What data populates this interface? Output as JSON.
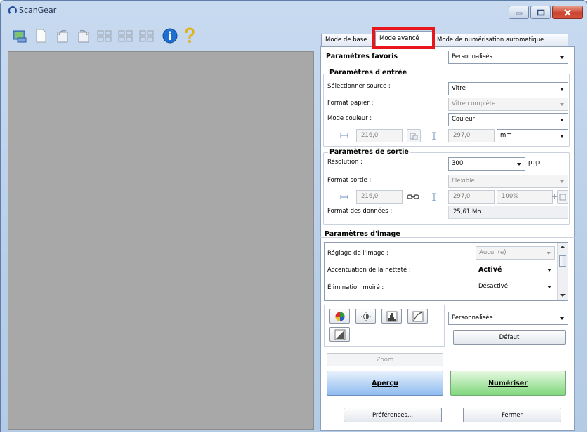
{
  "window": {
    "title": "ScanGear"
  },
  "toolbar": {
    "icons": [
      "scan-icon",
      "blank-page-icon",
      "rotate-left-icon",
      "rotate-right-icon",
      "thumbnail-view-icon",
      "grid-view-icon",
      "multi-crop-icon",
      "info-icon",
      "help-icon"
    ]
  },
  "tabs": [
    {
      "label": "Mode de base"
    },
    {
      "label": "Mode avancé"
    },
    {
      "label": "Mode de numérisation automatique"
    }
  ],
  "favorites": {
    "label": "Paramètres favoris",
    "value": "Personnalisés"
  },
  "input_settings": {
    "title": "Paramètres d'entrée",
    "source_label": "Sélectionner source :",
    "source_value": "Vitre",
    "paper_label": "Format papier :",
    "paper_value": "Vitre complète",
    "color_label": "Mode couleur :",
    "color_value": "Couleur",
    "width": "216,0",
    "height": "297,0",
    "unit": "mm"
  },
  "output_settings": {
    "title": "Paramètres de sortie",
    "resolution_label": "Résolution :",
    "resolution_value": "300",
    "resolution_unit": "ppp",
    "format_label": "Format sortie :",
    "format_value": "Flexible",
    "width": "216,0",
    "height": "297,0",
    "scale": "100%",
    "data_size_label": "Format des données :",
    "data_size_value": "25,61 Mo"
  },
  "image_settings": {
    "title": "Paramètres d'image",
    "rows": [
      {
        "label": "Réglage de l'image :",
        "value": "Aucun(e)"
      },
      {
        "label": "Accentuation de la netteté :",
        "value": "Activé"
      },
      {
        "label": "Élimination moiré :",
        "value": "Désactivé"
      }
    ]
  },
  "color_tools": {
    "preset_value": "Personnalisée",
    "default_label": "Défaut"
  },
  "buttons": {
    "zoom": "Zoom",
    "preview": "Aperçu",
    "scan": "Numériser",
    "preferences": "Préférences...",
    "close": "Fermer"
  }
}
